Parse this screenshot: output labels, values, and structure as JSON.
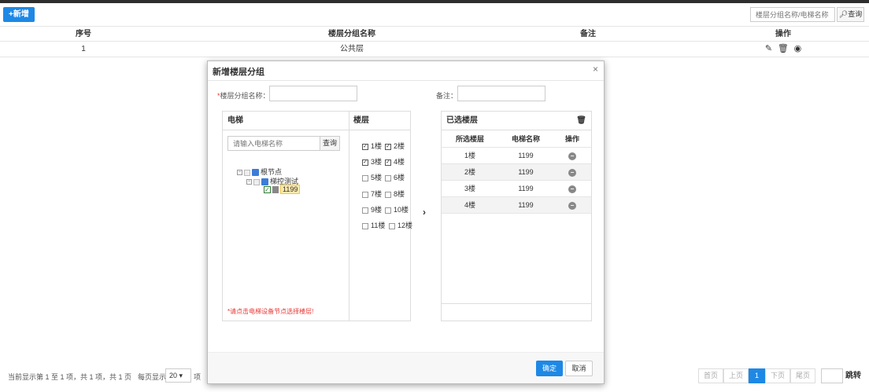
{
  "toolbar": {
    "add_label": "+新增",
    "search_placeholder": "楼层分组名称/电梯名称",
    "search_label": "查询"
  },
  "grid": {
    "columns": [
      "序号",
      "楼层分组名称",
      "备注",
      "操作"
    ],
    "rows": [
      {
        "index": "1",
        "name": "公共层",
        "note": ""
      }
    ],
    "row_actions": [
      "edit-icon",
      "delete-icon",
      "view-icon"
    ]
  },
  "pager": {
    "info": "当前显示第 1 至 1 项，共 1 项，共 1 页",
    "per_page_label": "每页显示",
    "per_page_value": "20 ▾",
    "item_label": "项",
    "first": "首页",
    "prev": "上页",
    "current": "1",
    "next": "下页",
    "last": "尾页",
    "go": "跳转"
  },
  "modal": {
    "title": "新增楼层分组",
    "close": "×",
    "name_label": "楼层分组名称：",
    "name_required": "*",
    "note_label": "备注：",
    "elevator_panel_title": "电梯",
    "floor_panel_title": "楼层",
    "elevator_search_placeholder": "请输入电梯名称",
    "elevator_search_btn": "查询",
    "tree": [
      {
        "label": "根节点",
        "level": 0
      },
      {
        "label": "梯控测试",
        "level": 1
      },
      {
        "label": "1199",
        "level": 2,
        "selected": true
      }
    ],
    "floors": [
      {
        "label": "1楼",
        "checked": true
      },
      {
        "label": "2楼",
        "checked": true
      },
      {
        "label": "3楼",
        "checked": true
      },
      {
        "label": "4楼",
        "checked": true
      },
      {
        "label": "5楼",
        "checked": false
      },
      {
        "label": "6楼",
        "checked": false
      },
      {
        "label": "7楼",
        "checked": false
      },
      {
        "label": "8楼",
        "checked": false
      },
      {
        "label": "9楼",
        "checked": false
      },
      {
        "label": "10楼",
        "checked": false
      },
      {
        "label": "11楼",
        "checked": false
      },
      {
        "label": "12楼",
        "checked": false
      }
    ],
    "hint": "*请点击电梯设备节点选择楼层!",
    "arrow": "›",
    "selected_panel_title": "已选楼层",
    "selected_columns": [
      "所选楼层",
      "电梯名称",
      "操作"
    ],
    "selected_rows": [
      {
        "floor": "1楼",
        "elevator": "1199"
      },
      {
        "floor": "2楼",
        "elevator": "1199"
      },
      {
        "floor": "3楼",
        "elevator": "1199"
      },
      {
        "floor": "4楼",
        "elevator": "1199"
      }
    ],
    "ok_label": "确定",
    "cancel_label": "取消"
  }
}
